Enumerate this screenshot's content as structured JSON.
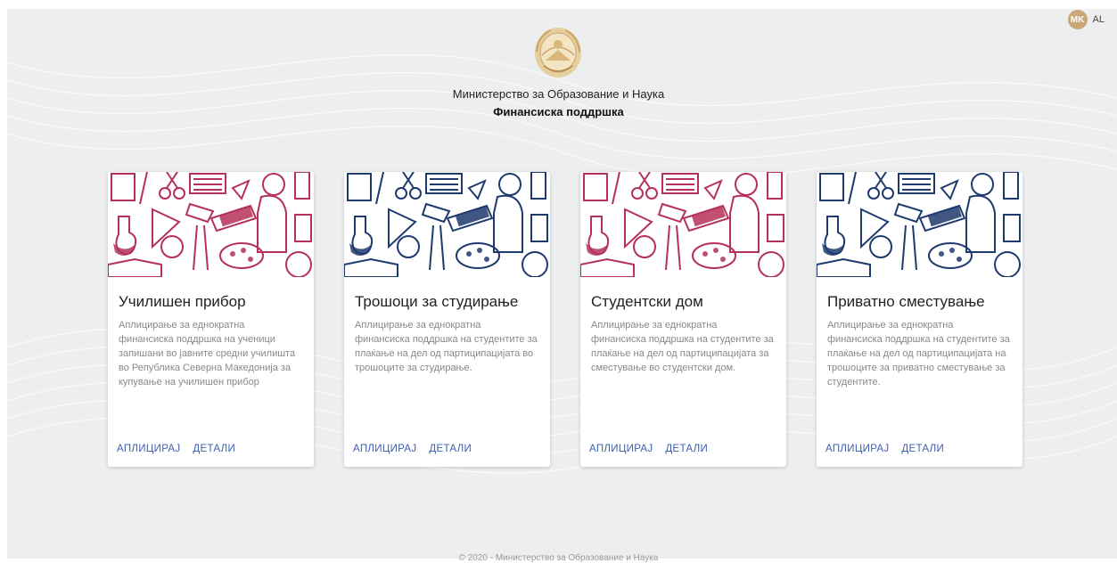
{
  "header": {
    "ministry": "Министерство за Образование и Наука",
    "subtitle": "Финансиска поддршка"
  },
  "language": {
    "options": [
      "MK",
      "AL"
    ],
    "active": "MK",
    "active_color": "#c9a777"
  },
  "emblem_icon": "coat-of-arms-icon",
  "cards": [
    {
      "title": "Училишен прибор",
      "description": "Аплицирање за еднократна финансиска поддршка на ученици запишани во јавните средни училишта во Република Северна Македонија за купување на училишен прибор",
      "apply": "АПЛИЦИРАЈ",
      "details": "ДЕТАЛИ",
      "illustration_color": "#b5315a"
    },
    {
      "title": "Трошоци за студирање",
      "description": "Аплицирање за еднократна финансиска поддршка на студентите за плаќање на дел од партиципацијата во трошоците за студирање.",
      "apply": "АПЛИЦИРАЈ",
      "details": "ДЕТАЛИ",
      "illustration_color": "#1f3a6e"
    },
    {
      "title": "Студентски дом",
      "description": "Аплицирање за еднократна финансиска поддршка на студентите за плаќање на дел од партиципацијата за сместување во студентски дом.",
      "apply": "АПЛИЦИРАЈ",
      "details": "ДЕТАЛИ",
      "illustration_color": "#b5315a"
    },
    {
      "title": "Приватно сместување",
      "description": "Аплицирање за еднократна финансиска поддршка на студентите за плаќање на дел од партиципацијата на трошоците за приватно сместување за студентите.",
      "apply": "АПЛИЦИРАЈ",
      "details": "ДЕТАЛИ",
      "illustration_color": "#1f3a6e"
    }
  ],
  "footer": "© 2020 - Министерство за Образование и Наука",
  "colors": {
    "background": "#eceeef",
    "link": "#3d5fae",
    "emblem_gold": "#d9b77a"
  }
}
